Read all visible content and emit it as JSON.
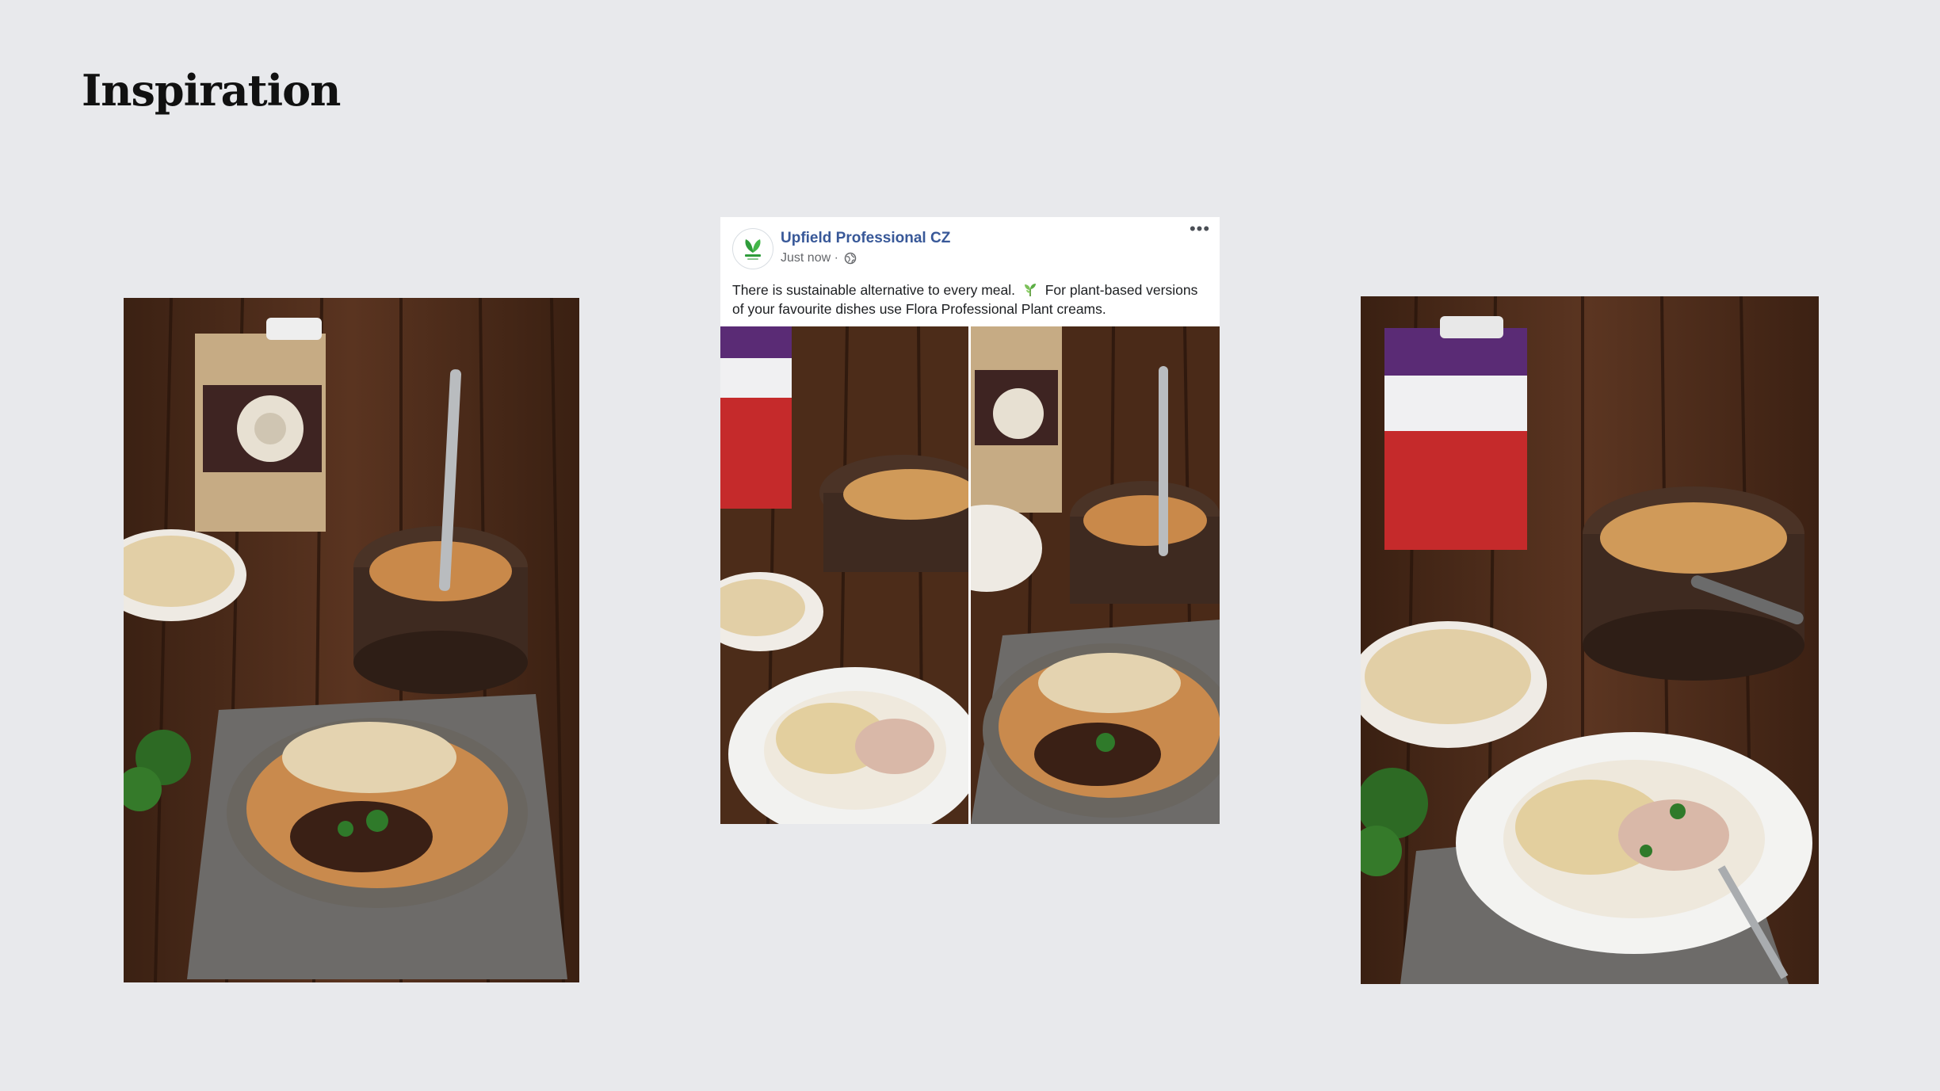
{
  "slide": {
    "title": "Inspiration"
  },
  "post": {
    "page_name": "Upfield Professional CZ",
    "timestamp": "Just now",
    "separator": "·",
    "privacy_icon": "globe-icon",
    "more_icon": "more-options-icon",
    "text_part1": "There is sustainable alternative to every meal.",
    "emoji_icon": "sprout-icon",
    "text_part2": "For plant-based versions of your favourite dishes use Flora Professional Plant creams.",
    "name_color": "#385898"
  },
  "images": {
    "left_photo": "flora-plant-goulash-photo",
    "right_photo": "rama-cremefine-pasta-photo",
    "post_image_1": "rama-pasta-crop",
    "post_image_2": "flora-goulash-crop"
  },
  "palette": {
    "background": "#e8e9ec",
    "wood": "#4a2a18"
  }
}
